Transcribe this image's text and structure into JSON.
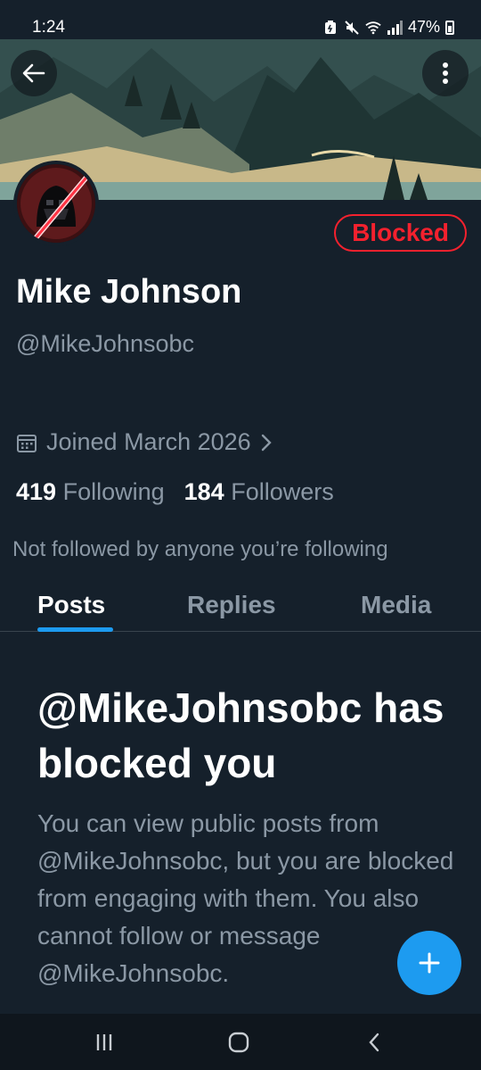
{
  "status_bar": {
    "time": "1:24",
    "battery": "47%",
    "icons": [
      "battery-saver-icon",
      "mute-icon",
      "wifi-icon",
      "signal-icon",
      "battery-icon"
    ]
  },
  "header": {
    "back_icon": "arrow-left-icon",
    "more_icon": "more-vertical-icon"
  },
  "profile": {
    "blocked_label": "Blocked",
    "name": "Mike Johnson",
    "handle": "@MikeJohnsobc",
    "joined": "Joined March 2026",
    "following_count": "419",
    "following_label": "Following",
    "followers_count": "184",
    "followers_label": "Followers",
    "not_followed": "Not followed by anyone you’re following"
  },
  "tabs": [
    {
      "label": "Posts",
      "active": true
    },
    {
      "label": "Replies",
      "active": false
    },
    {
      "label": "Media",
      "active": false
    }
  ],
  "blocked_notice": {
    "title": "@MikeJohnsobc has blocked you",
    "description": "You can view public posts from @MikeJohnsobc, but you are blocked from engaging with them. You also cannot follow or message @MikeJohnsobc."
  },
  "fab": {
    "icon": "plus-icon"
  },
  "colors": {
    "background": "#15202b",
    "accent": "#1d9bf0",
    "blocked_red": "#f4212e",
    "secondary_text": "#8b98a5"
  }
}
